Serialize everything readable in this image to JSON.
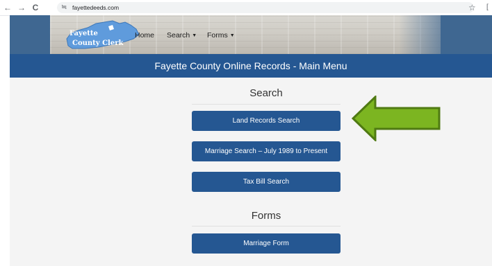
{
  "browser": {
    "back_icon": "←",
    "forward_icon": "→",
    "reload_icon": "C",
    "site_settings_icon": "≒",
    "url": "fayettedeeds.com",
    "bookmark_icon": "☆",
    "extension_icon": "["
  },
  "header": {
    "logo_line1": "Fayette",
    "logo_line2": "County Clerk",
    "nav": {
      "home": "Home",
      "search": "Search",
      "forms": "Forms",
      "caret": "▼"
    }
  },
  "title_bar": {
    "title": "Fayette County Online Records - Main Menu"
  },
  "main": {
    "search_heading": "Search",
    "search_buttons": [
      "Land Records Search",
      "Marriage Search – July 1989 to Present",
      "Tax Bill Search"
    ],
    "forms_heading": "Forms",
    "forms_buttons": [
      "Marriage Form"
    ]
  },
  "annotation": {
    "arrow_color": "#7cb521",
    "arrow_outline": "#4f7a12"
  },
  "colors": {
    "primary": "#255792",
    "banner": "#3f6791"
  }
}
